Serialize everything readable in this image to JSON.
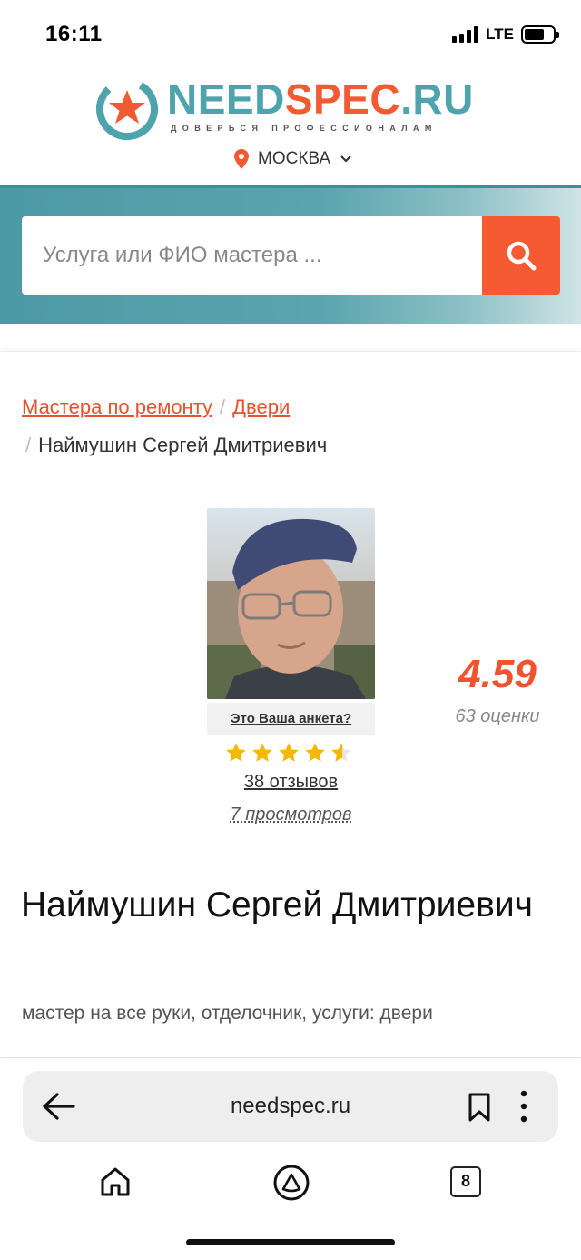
{
  "status_bar": {
    "time": "16:11",
    "network": "LTE"
  },
  "logo": {
    "need": "NEED",
    "spec": "SPEC",
    "ru": ".RU",
    "tagline": "ДОВЕРЬСЯ ПРОФЕССИОНАЛАМ"
  },
  "city": "МОСКВА",
  "search": {
    "placeholder": "Услуга или ФИО мастера ..."
  },
  "breadcrumb": {
    "items": [
      "Мастера по ремонту",
      "Двери"
    ],
    "current": "Наймушин Сергей Дмитриевич"
  },
  "profile": {
    "claim_label": "Это Ваша анкета?",
    "stars_value": 4.5,
    "stars_max": 5,
    "reviews": "38 отзывов",
    "views": "7 просмотров",
    "rating": "4.59",
    "rating_count": "63 оценки",
    "name": "Наймушин Сергей Дмитриевич",
    "subtitle": "мастер на все руки, отделочник, услуги: двери"
  },
  "browser": {
    "url": "needspec.ru",
    "tab_count": "8"
  },
  "colors": {
    "accent": "#f25a33",
    "brand": "#4fa3ad",
    "star": "#f5b800"
  }
}
